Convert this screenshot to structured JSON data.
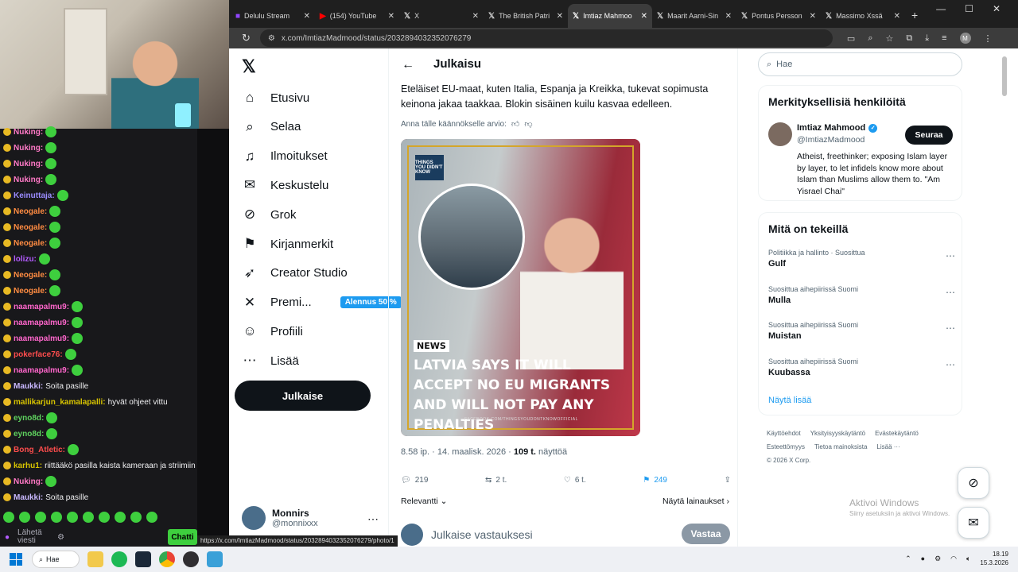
{
  "browser": {
    "tabs": [
      {
        "label": "Delulu Stream",
        "icon": "twitch-icon",
        "active": false
      },
      {
        "label": "(154) YouTube",
        "icon": "youtube-icon",
        "active": false
      },
      {
        "label": "X",
        "icon": "x-icon",
        "active": false
      },
      {
        "label": "The British Patri",
        "icon": "x-icon",
        "active": false
      },
      {
        "label": "Imtiaz Mahmoo",
        "icon": "x-icon",
        "active": true
      },
      {
        "label": "Maarit Aarni-Sin",
        "icon": "x-icon",
        "active": false
      },
      {
        "label": "Pontus Persson",
        "icon": "x-icon",
        "active": false
      },
      {
        "label": "Massimo Xssä",
        "icon": "x-icon",
        "active": false
      }
    ],
    "url": "x.com/ImtiazMadmood/status/2032894032352076279",
    "status_url": "https://x.com/ImtiazMadmood/status/2032894032352076279/photo/1"
  },
  "chat": {
    "lines": [
      {
        "user": "Nuking:",
        "color": "#ff79c6",
        "msg": "",
        "emote": true
      },
      {
        "user": "Nuking:",
        "color": "#ff79c6",
        "msg": "",
        "emote": true
      },
      {
        "user": "Nuking:",
        "color": "#ff79c6",
        "msg": "",
        "emote": true
      },
      {
        "user": "Nuking:",
        "color": "#ff79c6",
        "msg": "",
        "emote": true
      },
      {
        "user": "Keinuttaja:",
        "color": "#9b8cff",
        "msg": "",
        "emote": true
      },
      {
        "user": "Neogale:",
        "color": "#ff8c42",
        "msg": "",
        "emote": true
      },
      {
        "user": "Neogale:",
        "color": "#ff8c42",
        "msg": "",
        "emote": true
      },
      {
        "user": "Neogale:",
        "color": "#ff8c42",
        "msg": "",
        "emote": true
      },
      {
        "user": "lolizu:",
        "color": "#b45cff",
        "msg": "",
        "emote": true
      },
      {
        "user": "Neogale:",
        "color": "#ff8c42",
        "msg": "",
        "emote": true
      },
      {
        "user": "Neogale:",
        "color": "#ff8c42",
        "msg": "",
        "emote": true
      },
      {
        "user": "naamapalmu9:",
        "color": "#ff66cc",
        "msg": "",
        "emote": true
      },
      {
        "user": "naamapalmu9:",
        "color": "#ff66cc",
        "msg": "",
        "emote": true
      },
      {
        "user": "naamapalmu9:",
        "color": "#ff66cc",
        "msg": "",
        "emote": true
      },
      {
        "user": "pokerface76:",
        "color": "#ff4d4d",
        "msg": "",
        "emote": true
      },
      {
        "user": "naamapalmu9:",
        "color": "#ff66cc",
        "msg": "",
        "emote": true
      },
      {
        "user": "Maukki:",
        "color": "#c9b8ff",
        "msg": "Soita pasille",
        "emote": false
      },
      {
        "user": "mallikarjun_kamalapalli:",
        "color": "#d8c400",
        "msg": "hyvät ohjeet vittu",
        "emote": false
      },
      {
        "user": "eyno8d:",
        "color": "#5fd35f",
        "msg": "",
        "emote": true
      },
      {
        "user": "eyno8d:",
        "color": "#5fd35f",
        "msg": "",
        "emote": true
      },
      {
        "user": "Bong_Atletic:",
        "color": "#ff4d4d",
        "msg": "",
        "emote": true
      },
      {
        "user": "karhu1:",
        "color": "#d8c400",
        "msg": "riittääkö pasilla kaista kameraan ja striimiin",
        "emote": false
      },
      {
        "user": "Nuking:",
        "color": "#ff79c6",
        "msg": "",
        "emote": true
      },
      {
        "user": "Maukki:",
        "color": "#c9b8ff",
        "msg": "Soita pasille",
        "emote": false
      }
    ],
    "send_placeholder": "Lähetä viesti",
    "chat_button": "Chatti"
  },
  "x": {
    "nav": [
      {
        "label": "Etusivu",
        "icon": "home-icon",
        "glyph": "⌂"
      },
      {
        "label": "Selaa",
        "icon": "search-icon",
        "glyph": "⌕"
      },
      {
        "label": "Ilmoitukset",
        "icon": "bell-icon",
        "glyph": "♫"
      },
      {
        "label": "Keskustelu",
        "icon": "mail-icon",
        "glyph": "✉"
      },
      {
        "label": "Grok",
        "icon": "grok-icon",
        "glyph": "⊘"
      },
      {
        "label": "Kirjanmerkit",
        "icon": "bookmark-icon",
        "glyph": "⚑"
      },
      {
        "label": "Creator Studio",
        "icon": "rocket-icon",
        "glyph": "➶"
      },
      {
        "label": "Premi...",
        "icon": "x-premium-icon",
        "glyph": "✕"
      },
      {
        "label": "Profiili",
        "icon": "profile-icon",
        "glyph": "☺"
      },
      {
        "label": "Lisää",
        "icon": "more-icon",
        "glyph": "⋯"
      }
    ],
    "premium_badge": "Alennus 50 %",
    "post_button": "Julkaise",
    "account": {
      "name": "Monnirs",
      "handle": "@monnixxx"
    },
    "header_title": "Julkaisu",
    "tweet_text": "Eteläiset EU-maat, kuten Italia, Espanja ja Kreikka, tukevat sopimusta keinona jakaa taakkaa. Blokin sisäinen kuilu kasvaa edelleen.",
    "rate_translation": "Anna tälle käännökselle arvio:",
    "media": {
      "tag": "NEWS",
      "headline": "LATVIA SAYS IT WILL ACCEPT NO EU MIGRANTS AND WILL NOT PAY ANY PENALTIES",
      "source": "FACEBOOK.COM/THINGSYOUDONTKNOWOFFICIAL",
      "logo": "THINGS YOU DIDN'T KNOW"
    },
    "meta_time": "8.58 ip. · 14. maalisk. 2026 · ",
    "meta_views_count": "109 t.",
    "meta_views_label": " näyttöä",
    "actions": {
      "replies": "219",
      "reposts": "2 t.",
      "likes": "6 t.",
      "bookmarks": "249"
    },
    "relevance": "Relevantti",
    "quotes": "Näytä lainaukset",
    "reply_placeholder": "Julkaise vastauksesi",
    "reply_button": "Vastaa",
    "search_placeholder": "Hae",
    "who_title": "Merkityksellisiä henkilöitä",
    "who": {
      "name": "Imtiaz Mahmood",
      "handle": "@ImtiazMadmood",
      "follow": "Seuraa",
      "bio": "Atheist, freethinker; exposing Islam layer by layer, to let infidels know more about Islam than Muslims allow them to. \"Am Yisrael Chai\""
    },
    "trend_title": "Mitä on tekeillä",
    "trends": [
      {
        "context": "Politiikka ja hallinto · Suosittua",
        "name": "Gulf"
      },
      {
        "context": "Suosittua aihepiirissä Suomi",
        "name": "Mulla"
      },
      {
        "context": "Suosittua aihepiirissä Suomi",
        "name": "Muistan"
      },
      {
        "context": "Suosittua aihepiirissä Suomi",
        "name": "Kuubassa"
      }
    ],
    "show_more": "Näytä lisää",
    "footer": [
      "Käyttöehdot",
      "Yksityisyyskäytäntö",
      "Evästekäytäntö",
      "Esteettömyys",
      "Tietoa mainoksista",
      "Lisää ···",
      "© 2026 X Corp."
    ]
  },
  "windows": {
    "activate_title": "Aktivoi Windows",
    "activate_sub": "Siirry asetuksiin ja aktivoi Windows.",
    "search": "Hae",
    "time": "18.19",
    "date": "15.3.2026"
  },
  "colors": {
    "accent": "#1d9bf0",
    "twitch_green": "#3ecf3e"
  }
}
